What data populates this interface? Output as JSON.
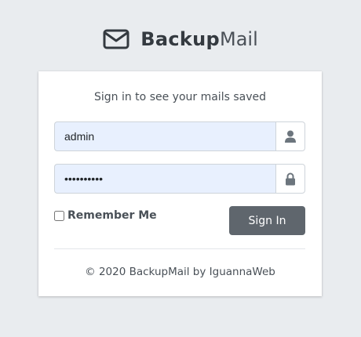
{
  "logo": {
    "brand_bold": "Backup",
    "brand_light": "Mail",
    "icon": "envelope-icon"
  },
  "login": {
    "message": "Sign in to see your mails saved",
    "username_value": "admin",
    "password_value": "••••••••••",
    "username_icon": "user-icon",
    "password_icon": "lock-icon",
    "remember_label": "Remember Me",
    "remember_checked": false,
    "signin_label": "Sign In"
  },
  "footer": {
    "text": "© 2020 BackupMail by IguannaWeb"
  },
  "colors": {
    "background": "#e9ecef",
    "autofill": "#e8f0fe",
    "button": "#5f666d"
  }
}
